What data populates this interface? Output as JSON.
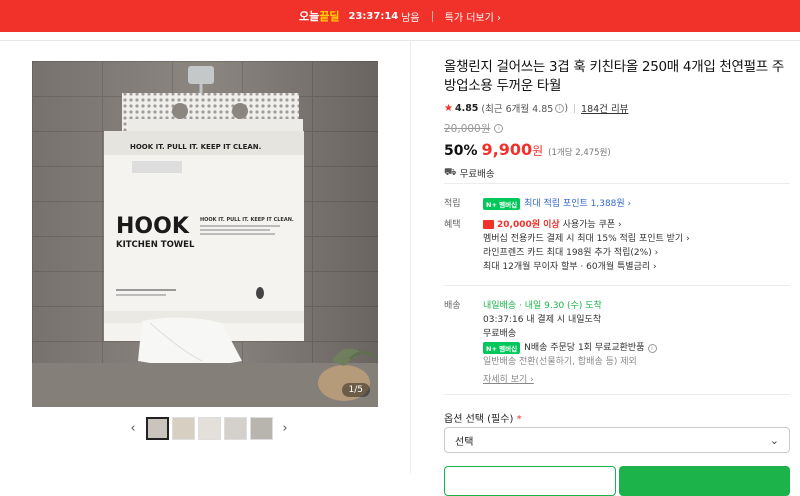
{
  "topbar": {
    "logo_a": "오늘",
    "logo_b": "끝딜",
    "time": "23:37:14",
    "time_suffix": "남음",
    "more": "특가 더보기 ›"
  },
  "gallery": {
    "counter": "1/5",
    "prev": "‹",
    "next": "›",
    "thumb_count": 5
  },
  "product": {
    "title": "올챙린지 걸어쓰는 3겹 훅 키친타올 250매 4개입 천연펄프 주방업소용 두꺼운 타월",
    "rating_score": "4.85",
    "rating_detail": "(최근 6개월 4.85",
    "rating_close": ")",
    "reviews": "184건 리뷰",
    "original_price": "20,000원",
    "discount": "50%",
    "sale_price": "9,900",
    "won": "원",
    "unit_price": "(1개당 2,475원)",
    "shipping": "무료배송"
  },
  "benefits": {
    "label_points": "적립",
    "points": "최대 적립 포인트 1,388원 ›",
    "label_benefit": "혜택",
    "coupon_amount": "20,000원 이상",
    "coupon_text": "사용가능 쿠폰 ›",
    "line2": "멤버십 전용카드 결제 시 최대 15% 적립 포인트 받기 ›",
    "line3": "라인프렌즈 카드 최대 198원 추가 적립(2%) ›",
    "line4": "최대 12개월 무이자 할부 · 60개월 특별금리 ›"
  },
  "delivery": {
    "label": "배송",
    "tomorrow": "내일배송",
    "arrive": "· 내일 9.30 (수) 도착",
    "cutoff": "03:37:16  내 결제 시 내일도착",
    "free": "무료배송",
    "nreturn": "N배송 주문당 1회 무료교환반품",
    "exclude": "일반배송 전환(선물하기, 합배송 등) 제외",
    "detail": "자세히 보기 ›"
  },
  "option": {
    "label": "옵션 선택 (필수)",
    "required": "*",
    "select": "선택"
  },
  "colors": {
    "accent": "#f0322b",
    "green": "#1cb34b"
  }
}
